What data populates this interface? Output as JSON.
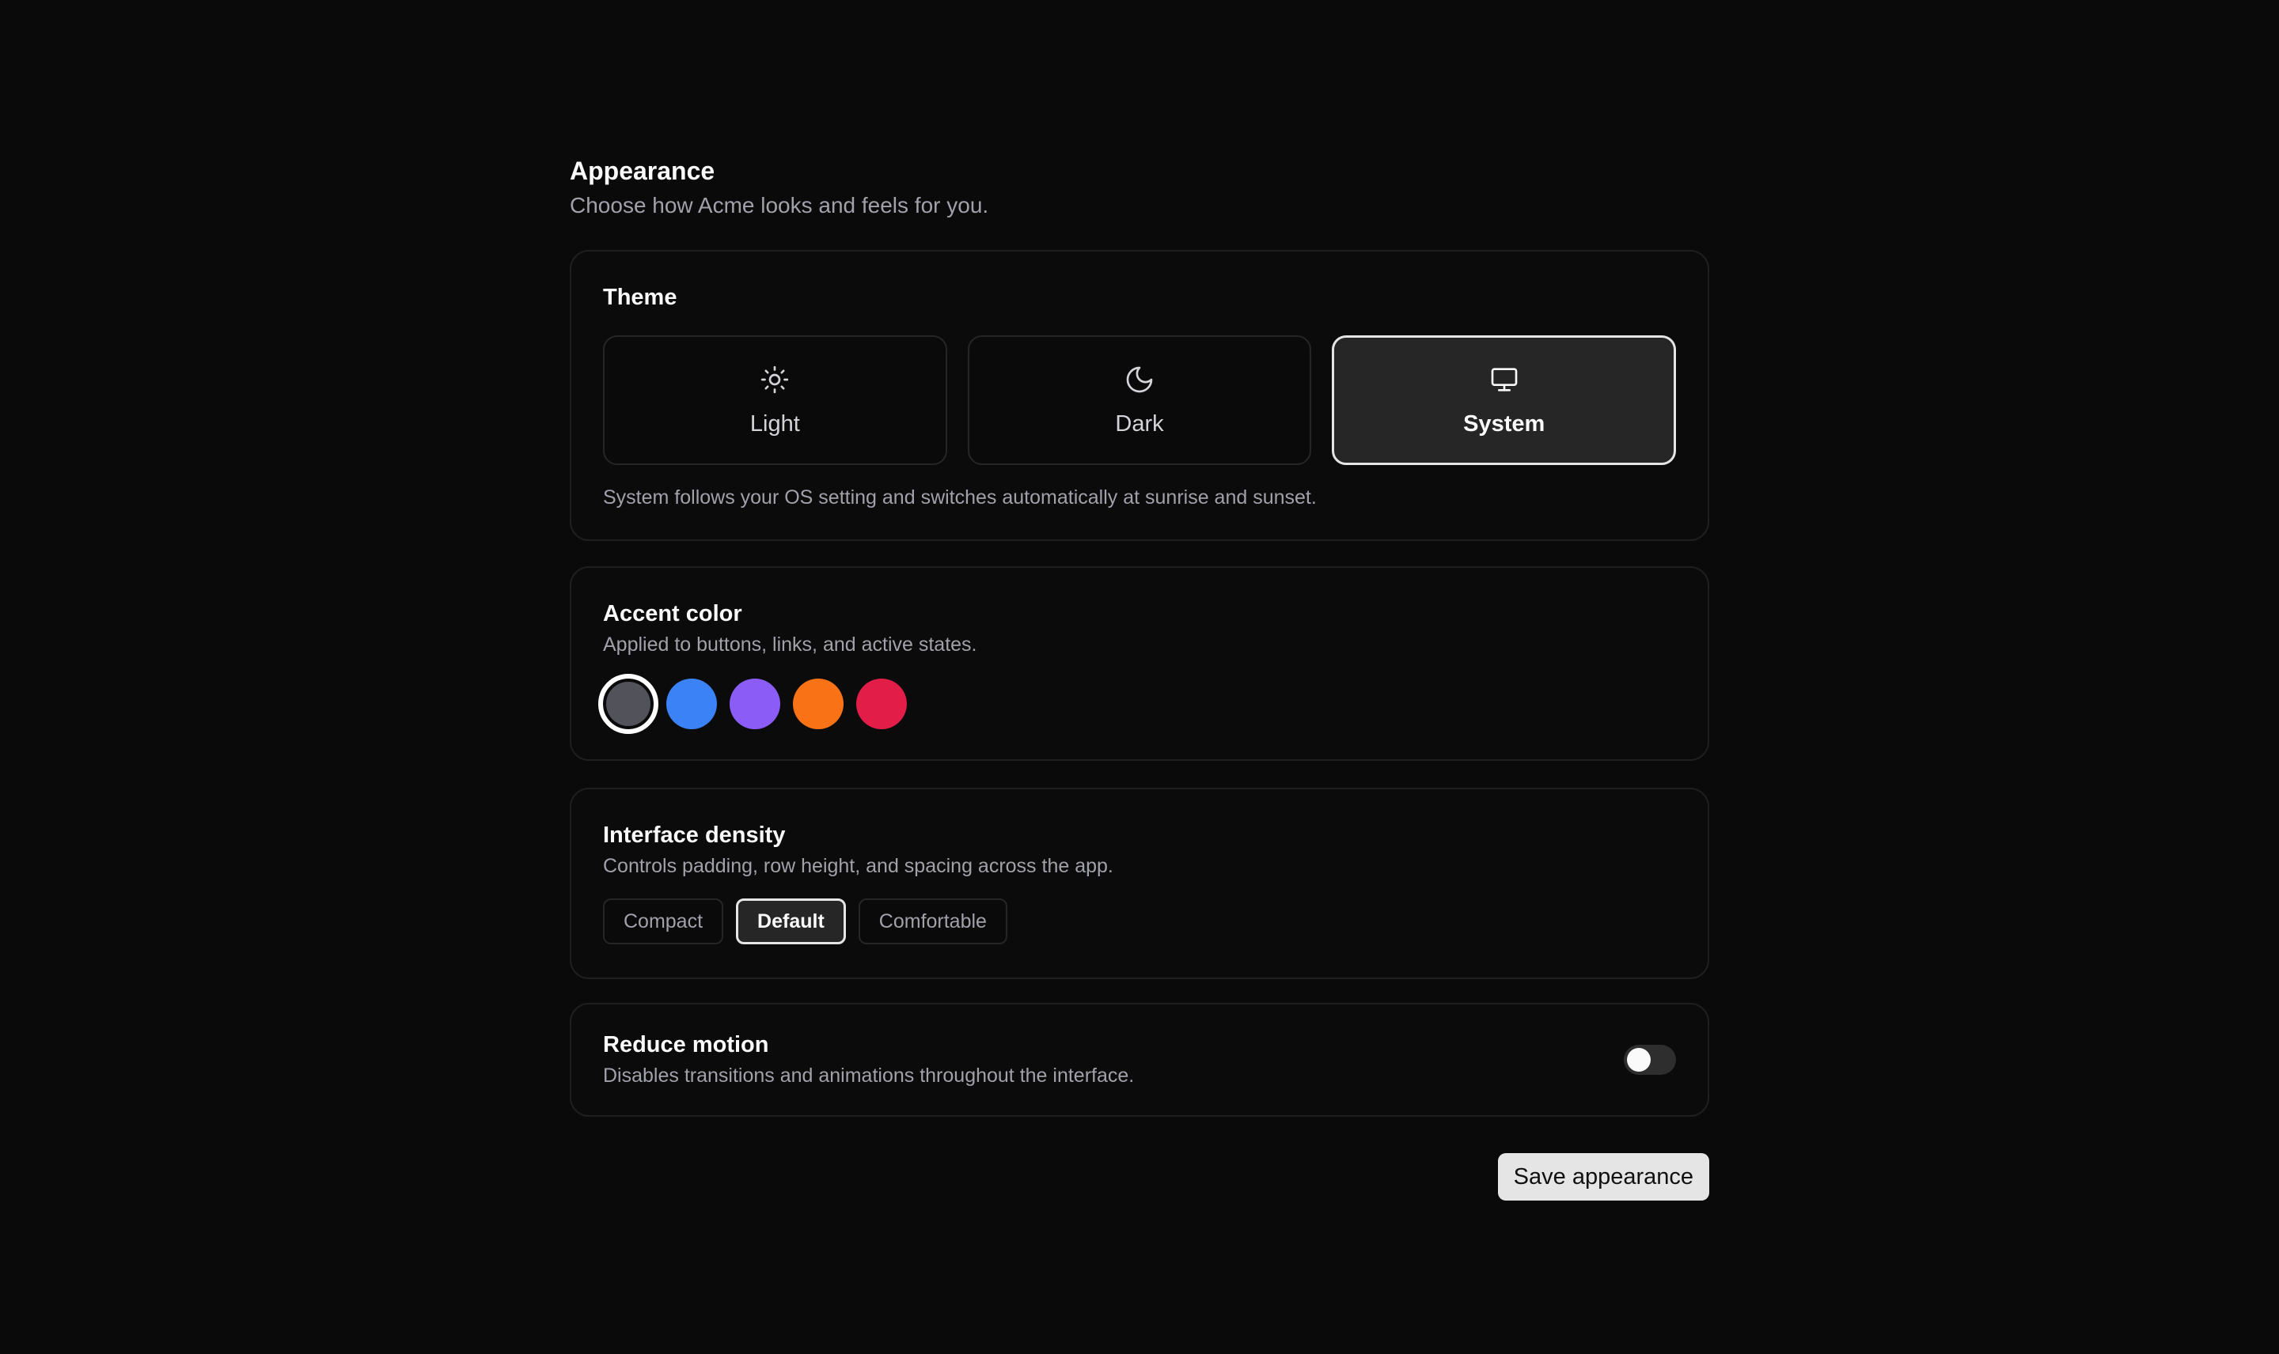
{
  "header": {
    "title": "Appearance",
    "subtitle": "Choose how Acme looks and feels for you."
  },
  "theme": {
    "title": "Theme",
    "options": [
      {
        "label": "Light",
        "icon": "sun-icon"
      },
      {
        "label": "Dark",
        "icon": "moon-icon"
      },
      {
        "label": "System",
        "icon": "monitor-icon"
      }
    ],
    "selected": "System",
    "note": "System follows your OS setting and switches automatically at sunrise and sunset."
  },
  "accent": {
    "title": "Accent color",
    "description": "Applied to buttons, links, and active states.",
    "swatches": [
      {
        "name": "gray",
        "color": "#52525b"
      },
      {
        "name": "blue",
        "color": "#3b82f6"
      },
      {
        "name": "purple",
        "color": "#8b5cf6"
      },
      {
        "name": "orange",
        "color": "#f97316"
      },
      {
        "name": "red",
        "color": "#e11d48"
      }
    ],
    "selected": "gray"
  },
  "density": {
    "title": "Interface density",
    "description": "Controls padding, row height, and spacing across the app.",
    "options": [
      "Compact",
      "Default",
      "Comfortable"
    ],
    "selected": "Default"
  },
  "motion": {
    "title": "Reduce motion",
    "description": "Disables transitions and animations throughout the interface.",
    "enabled": false
  },
  "actions": {
    "save_label": "Save appearance"
  }
}
